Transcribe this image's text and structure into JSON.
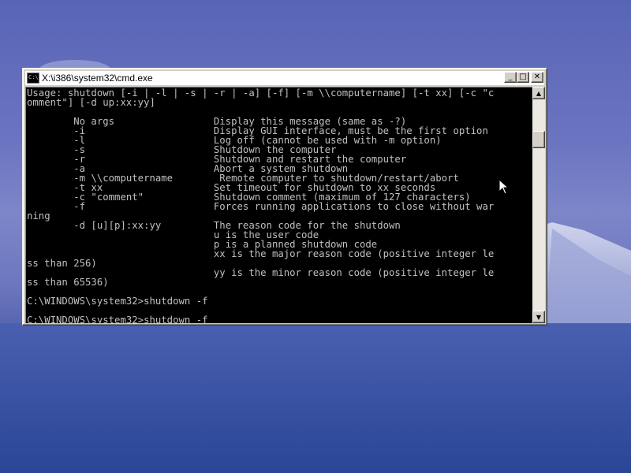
{
  "window": {
    "title": "X:\\i386\\system32\\cmd.exe",
    "icon_text": "C:\\",
    "minimize_glyph": "_",
    "maximize_glyph": "□",
    "close_glyph": "✕"
  },
  "console": {
    "text": "Usage: shutdown [-i | -l | -s | -r | -a] [-f] [-m \\\\computername] [-t xx] [-c \"c\nomment\"] [-d up:xx:yy]\n\n        No args                 Display this message (same as -?)\n        -i                      Display GUI interface, must be the first option\n        -l                      Log off (cannot be used with -m option)\n        -s                      Shutdown the computer\n        -r                      Shutdown and restart the computer\n        -a                      Abort a system shutdown\n        -m \\\\computername        Remote computer to shutdown/restart/abort\n        -t xx                   Set timeout for shutdown to xx seconds\n        -c \"comment\"            Shutdown comment (maximum of 127 characters)\n        -f                      Forces running applications to close without war\nning\n        -d [u][p]:xx:yy         The reason code for the shutdown\n                                u is the user code\n                                p is a planned shutdown code\n                                xx is the major reason code (positive integer le\nss than 256)\n                                yy is the minor reason code (positive integer le\nss than 65536)\n\nC:\\WINDOWS\\system32>shutdown -f\n\nC:\\WINDOWS\\system32>shutdown -f"
  },
  "scrollbar": {
    "up_glyph": "▲",
    "down_glyph": "▼"
  },
  "colors": {
    "console_bg": "#000000",
    "console_fg": "#c0c0c0",
    "titlebar_bg": "#ffffff",
    "desktop_sky": "#6b74c0",
    "desktop_ground": "#2a4696"
  }
}
